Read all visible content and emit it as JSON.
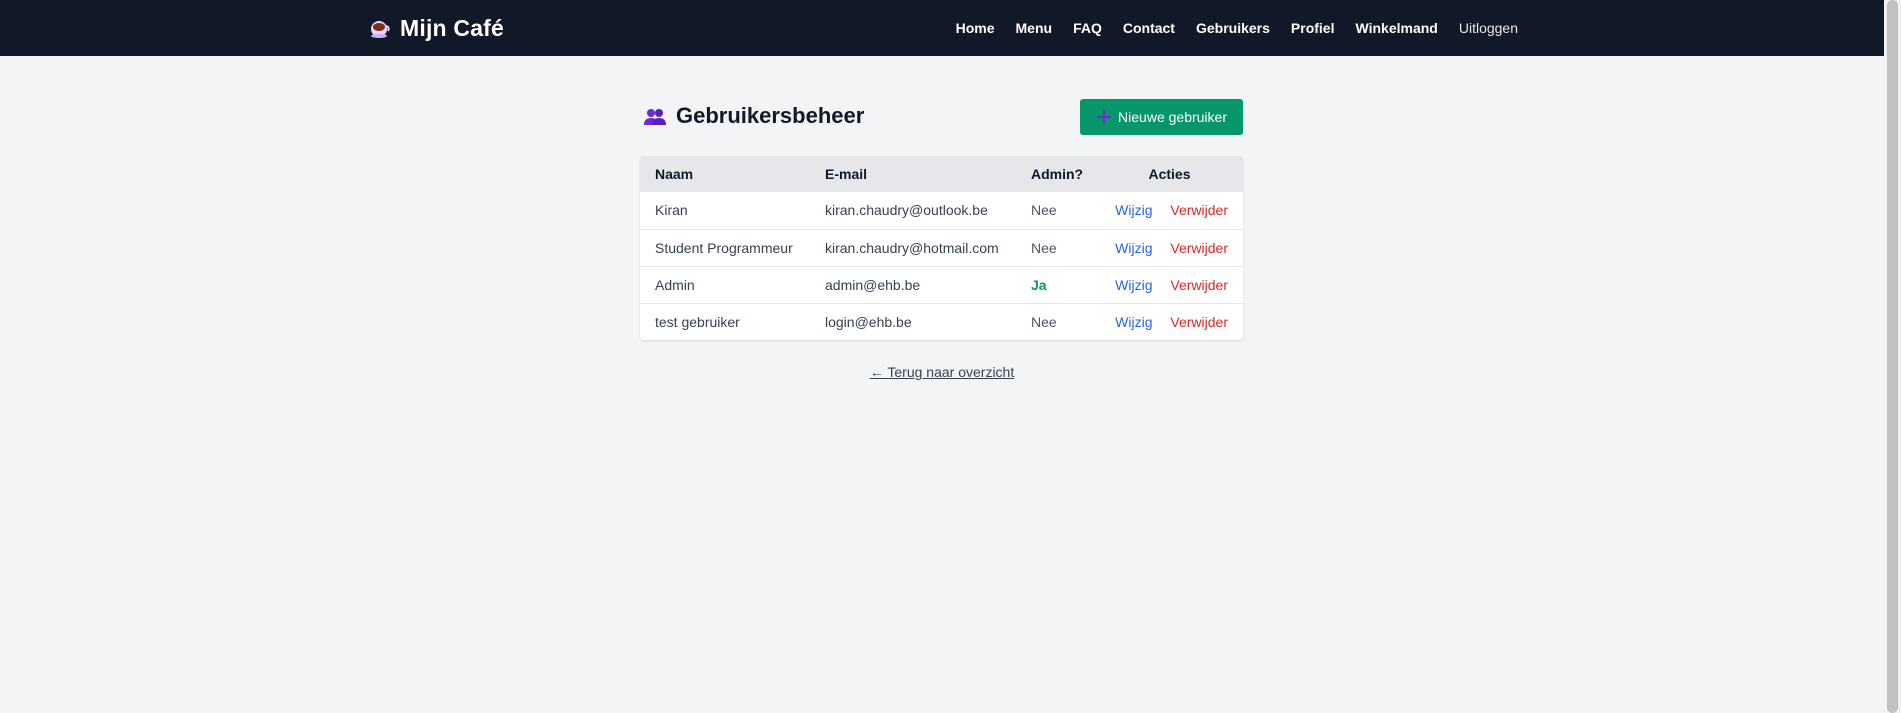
{
  "brand": {
    "name": "Mijn Café",
    "icon": "coffee-cup-icon"
  },
  "nav": {
    "home": "Home",
    "menu": "Menu",
    "faq": "FAQ",
    "contact": "Contact",
    "users": "Gebruikers",
    "profile": "Profiel",
    "cart": "Winkelmand",
    "logout": "Uitloggen"
  },
  "page": {
    "title": "Gebruikersbeheer",
    "title_icon": "users-icon",
    "new_user_button": "Nieuwe gebruiker"
  },
  "table": {
    "headers": {
      "name": "Naam",
      "email": "E-mail",
      "admin": "Admin?",
      "actions": "Acties"
    },
    "edit_label": "Wijzig",
    "delete_label": "Verwijder",
    "rows": [
      {
        "name": "Kiran",
        "email": "kiran.chaudry@outlook.be",
        "admin": "Nee"
      },
      {
        "name": "Student Programmeur",
        "email": "kiran.chaudry@hotmail.com",
        "admin": "Nee"
      },
      {
        "name": "Admin",
        "email": "admin@ehb.be",
        "admin": "Ja"
      },
      {
        "name": "test gebruiker",
        "email": "login@ehb.be",
        "admin": "Nee"
      }
    ]
  },
  "back_link": "← Terug naar overzicht",
  "colors": {
    "navbar": "#111827",
    "primary_button": "#059669",
    "edit": "#2563eb",
    "delete": "#dc2626",
    "admin_yes": "#059669"
  }
}
